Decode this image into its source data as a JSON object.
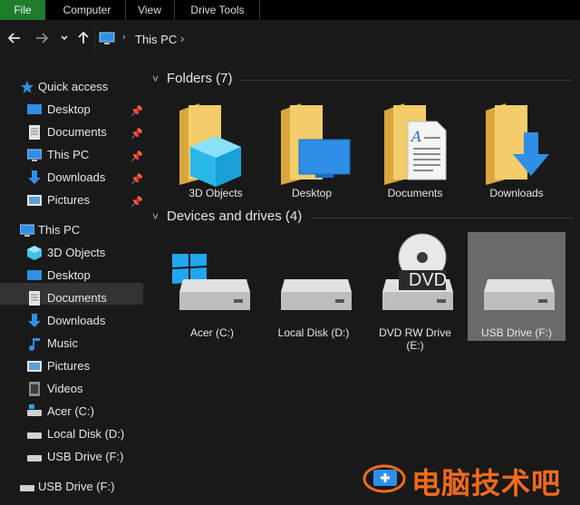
{
  "ribbon": {
    "tabs": [
      {
        "label": "File"
      },
      {
        "label": "Computer"
      },
      {
        "label": "View"
      },
      {
        "label": "Drive Tools"
      }
    ]
  },
  "address": {
    "path": "This PC"
  },
  "sidebar": {
    "quick_access": {
      "label": "Quick access",
      "items": [
        {
          "label": "Desktop",
          "pinned": true
        },
        {
          "label": "Documents",
          "pinned": true
        },
        {
          "label": "This PC",
          "pinned": true
        },
        {
          "label": "Downloads",
          "pinned": true
        },
        {
          "label": "Pictures",
          "pinned": true
        }
      ]
    },
    "this_pc": {
      "label": "This PC",
      "items": [
        {
          "label": "3D Objects"
        },
        {
          "label": "Desktop"
        },
        {
          "label": "Documents"
        },
        {
          "label": "Downloads"
        },
        {
          "label": "Music"
        },
        {
          "label": "Pictures"
        },
        {
          "label": "Videos"
        },
        {
          "label": "Acer (C:)"
        },
        {
          "label": "Local Disk (D:)"
        },
        {
          "label": "USB Drive (F:)"
        }
      ]
    },
    "usb": {
      "label": "USB Drive (F:)"
    }
  },
  "content": {
    "folders_header": "Folders (7)",
    "folders": [
      {
        "label": "3D Objects"
      },
      {
        "label": "Desktop"
      },
      {
        "label": "Documents"
      },
      {
        "label": "Downloads"
      }
    ],
    "devices_header": "Devices and drives (4)",
    "devices": [
      {
        "label": "Acer (C:)"
      },
      {
        "label": "Local Disk (D:)"
      },
      {
        "label": "DVD RW Drive",
        "label2": "(E:)",
        "badge": "DVD"
      },
      {
        "label": "USB Drive (F:)"
      }
    ]
  },
  "watermark": {
    "text": "电脑技术吧"
  },
  "colors": {
    "accent_green": "#1e7c2b",
    "folder_yellow": "#f0c25a",
    "blue": "#2f8fe6",
    "watermark_orange": "#f46a1e"
  }
}
